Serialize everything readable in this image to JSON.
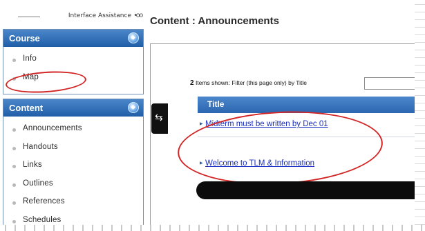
{
  "header": {
    "assistance_label": "Interface Assistance",
    "assistance_dots": "•oo",
    "title": "Content : Announcements"
  },
  "sidebar": {
    "course": {
      "title": "Course",
      "items": [
        {
          "label": "Info"
        },
        {
          "label": "Map"
        }
      ]
    },
    "content": {
      "title": "Content",
      "items": [
        {
          "label": "Announcements"
        },
        {
          "label": "Handouts"
        },
        {
          "label": "Links"
        },
        {
          "label": "Outlines"
        },
        {
          "label": "References"
        },
        {
          "label": "Schedules"
        }
      ]
    }
  },
  "main": {
    "items_count": "2",
    "items_text": "Items shown: Filter (this page only) by Title",
    "filter_value": "",
    "table_header": "Title",
    "rows": [
      {
        "title": "Midterm must be written by Dec 01"
      },
      {
        "title": "Welcome to TLM & Information"
      }
    ]
  },
  "colors": {
    "panel_blue": "#2b66b0",
    "annotation_red": "#d32626",
    "link_blue": "#1a2fbf"
  },
  "icons": [
    "panel-toggle-icon",
    "collapse-sidebar-icon",
    "row-arrow-icon"
  ]
}
